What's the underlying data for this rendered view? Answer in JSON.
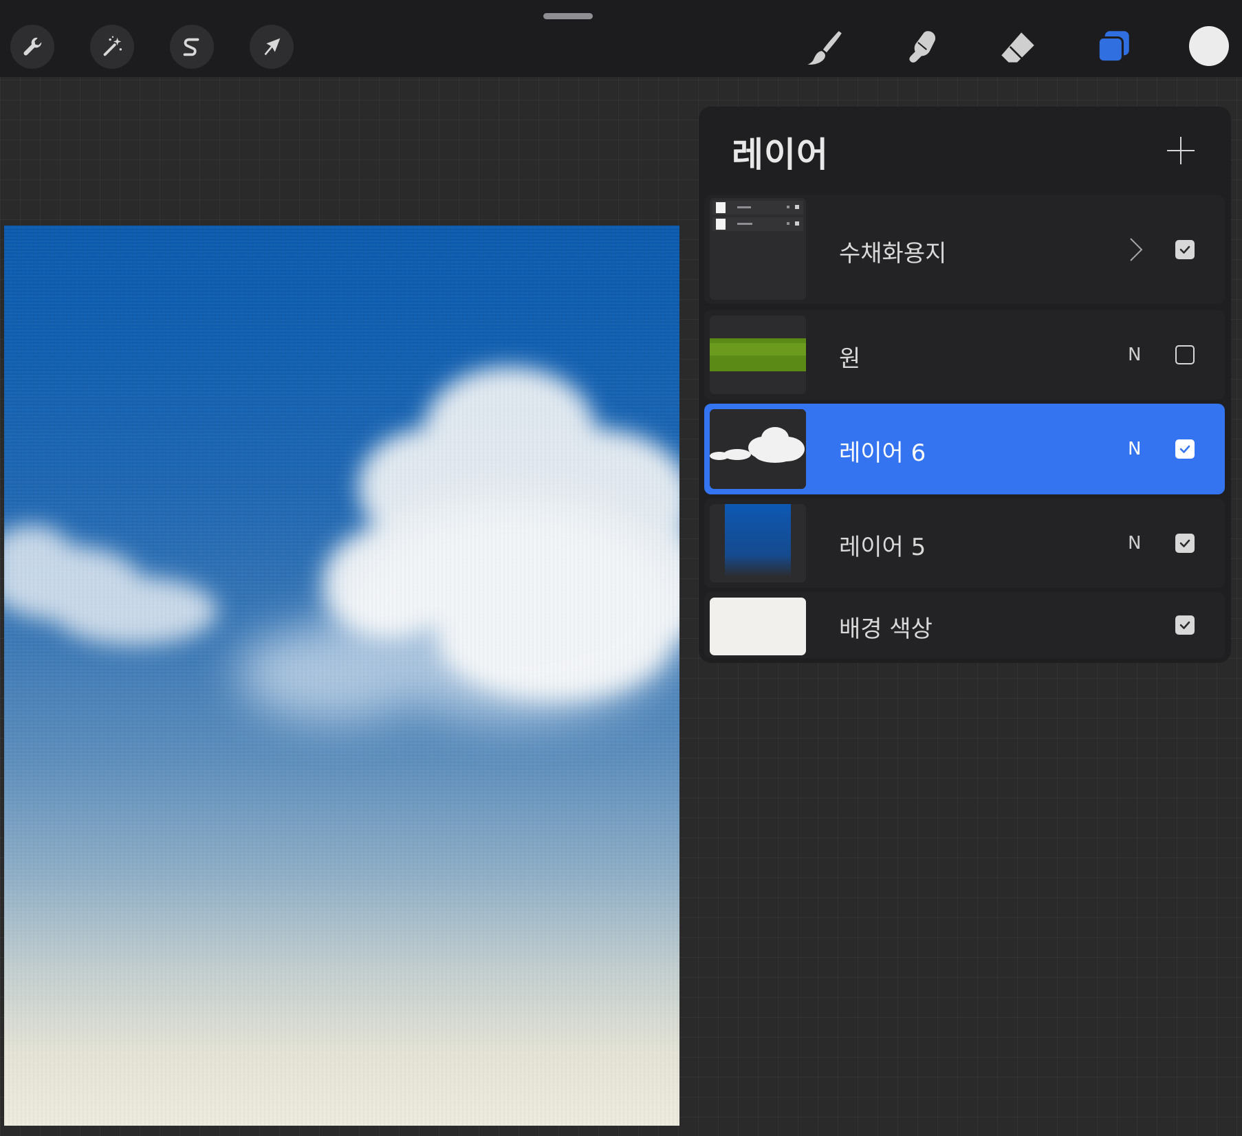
{
  "toolbar": {
    "left_tools": [
      {
        "name": "actions",
        "icon": "wrench-icon"
      },
      {
        "name": "adjustments",
        "icon": "magic-wand-icon"
      },
      {
        "name": "selection",
        "icon": "selection-s-icon"
      },
      {
        "name": "transform",
        "icon": "arrow-cursor-icon"
      }
    ],
    "right_tools": [
      {
        "name": "brush",
        "icon": "brush-icon"
      },
      {
        "name": "smudge",
        "icon": "smudge-finger-icon"
      },
      {
        "name": "eraser",
        "icon": "eraser-icon"
      },
      {
        "name": "layers",
        "icon": "layers-icon",
        "active": true
      }
    ],
    "current_color": "#ececec"
  },
  "layers_panel": {
    "title": "레이어",
    "layers": [
      {
        "name": "수채화용지",
        "kind": "group",
        "visible": true,
        "thumbnail": "panel-screenshot"
      },
      {
        "name": "원",
        "blend": "N",
        "visible": false,
        "thumbnail": "green-stroke"
      },
      {
        "name": "레이어 6",
        "blend": "N",
        "visible": true,
        "selected": true,
        "thumbnail": "cloud"
      },
      {
        "name": "레이어 5",
        "blend": "N",
        "visible": true,
        "thumbnail": "blue-gradient"
      },
      {
        "name": "배경 색상",
        "visible": true,
        "thumbnail": "background-fill"
      }
    ]
  },
  "colors": {
    "accent": "#3574f0",
    "toolbar": "#1c1c1e",
    "panel": "#1f1f21",
    "layers_icon": "#2f6fe0",
    "background_layer": "#f2f0ec"
  }
}
